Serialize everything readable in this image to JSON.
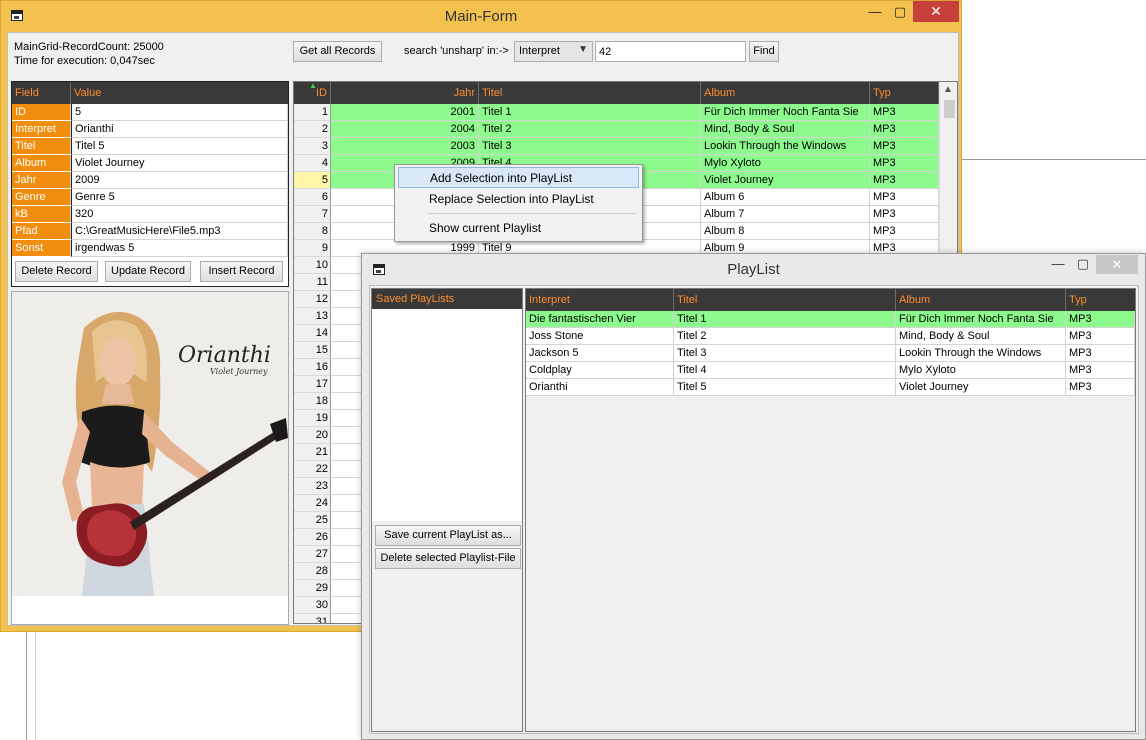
{
  "main_window": {
    "title": "Main-Form",
    "record_count": "MainGrid-RecordCount: 25000",
    "exec_time": "Time for execution: 0,047sec",
    "get_all_label": "Get all Records",
    "search_label": "search 'unsharp' in:->",
    "search_field": "Interpret",
    "search_value": "42",
    "find_label": "Find",
    "delete_label": "Delete Record",
    "update_label": "Update Record",
    "insert_label": "Insert Record"
  },
  "field_grid": {
    "headers": [
      "Field",
      "Value"
    ],
    "rows": [
      [
        "ID",
        "5"
      ],
      [
        "Interpret",
        "Orianthi"
      ],
      [
        "Titel",
        "Titel 5"
      ],
      [
        "Album",
        "Violet Journey"
      ],
      [
        "Jahr",
        "2009"
      ],
      [
        "Genre",
        "Genre 5"
      ],
      [
        "kB",
        "320"
      ],
      [
        "Pfad",
        "C:\\GreatMusicHere\\File5.mp3"
      ],
      [
        "Sonst",
        "irgendwas 5"
      ]
    ]
  },
  "album_art": {
    "artist_signature": "Orianthi",
    "album_text": "Violet Journey"
  },
  "main_grid": {
    "headers": [
      "ID",
      "Jahr",
      "Titel",
      "Album",
      "Typ"
    ],
    "rows": [
      {
        "id": "1",
        "jahr": "2001",
        "titel": "Titel 1",
        "album": "Für Dich Immer Noch Fanta Sie",
        "typ": "MP3",
        "green": true
      },
      {
        "id": "2",
        "jahr": "2004",
        "titel": "Titel 2",
        "album": "Mind, Body & Soul",
        "typ": "MP3",
        "green": true
      },
      {
        "id": "3",
        "jahr": "2003",
        "titel": "Titel 3",
        "album": "Lookin Through the Windows",
        "typ": "MP3",
        "green": true
      },
      {
        "id": "4",
        "jahr": "2009",
        "titel": "Titel 4",
        "album": "Mylo Xyloto",
        "typ": "MP3",
        "green": true
      },
      {
        "id": "5",
        "jahr": "",
        "titel": "",
        "album": "Violet Journey",
        "typ": "MP3",
        "green": true,
        "selected": true
      },
      {
        "id": "6",
        "jahr": "",
        "titel": "",
        "album": "Album 6",
        "typ": "MP3"
      },
      {
        "id": "7",
        "jahr": "",
        "titel": "",
        "album": "Album 7",
        "typ": "MP3"
      },
      {
        "id": "8",
        "jahr": "",
        "titel": "",
        "album": "Album 8",
        "typ": "MP3"
      },
      {
        "id": "9",
        "jahr": "1999",
        "titel": "Titel 9",
        "album": "Album 9",
        "typ": "MP3"
      },
      {
        "id": "10"
      },
      {
        "id": "11"
      },
      {
        "id": "12"
      },
      {
        "id": "13"
      },
      {
        "id": "14"
      },
      {
        "id": "15"
      },
      {
        "id": "16"
      },
      {
        "id": "17"
      },
      {
        "id": "18"
      },
      {
        "id": "19"
      },
      {
        "id": "20"
      },
      {
        "id": "21"
      },
      {
        "id": "22"
      },
      {
        "id": "23"
      },
      {
        "id": "24"
      },
      {
        "id": "25"
      },
      {
        "id": "26"
      },
      {
        "id": "27"
      },
      {
        "id": "28"
      },
      {
        "id": "29"
      },
      {
        "id": "30"
      },
      {
        "id": "31"
      }
    ]
  },
  "context_menu": {
    "items": [
      "Add Selection into PlayList",
      "Replace Selection into PlayList",
      "Show current Playlist"
    ]
  },
  "playlist_window": {
    "title": "PlayList",
    "saved_header": "Saved PlayLists",
    "save_label": "Save current PlayList as...",
    "delete_label": "Delete selected Playlist-File",
    "headers": [
      "Interpret",
      "Titel",
      "Album",
      "Typ"
    ],
    "rows": [
      {
        "interpret": "Die fantastischen Vier",
        "titel": "Titel 1",
        "album": "Für Dich Immer Noch Fanta Sie",
        "typ": "MP3",
        "green": true
      },
      {
        "interpret": "Joss Stone",
        "titel": "Titel 2",
        "album": "Mind, Body & Soul",
        "typ": "MP3"
      },
      {
        "interpret": "Jackson 5",
        "titel": "Titel 3",
        "album": "Lookin Through the Windows",
        "typ": "MP3"
      },
      {
        "interpret": "Coldplay",
        "titel": "Titel 4",
        "album": "Mylo Xyloto",
        "typ": "MP3"
      },
      {
        "interpret": "Orianthi",
        "titel": "Titel 5",
        "album": "Violet Journey",
        "typ": "MP3"
      }
    ]
  },
  "colors": {
    "window_frame": "#f3c24e",
    "header_bg": "#393939",
    "header_text": "#ff8c2e",
    "field_bg": "#f28e0f",
    "highlight_green": "#8cfa8c",
    "selected_row_num": "#fff7a8"
  }
}
